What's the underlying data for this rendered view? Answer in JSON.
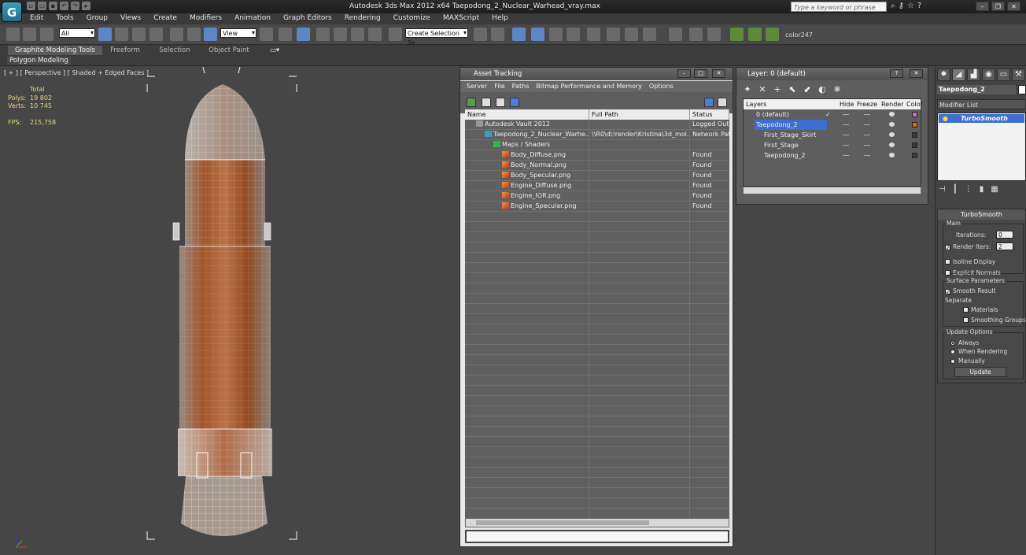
{
  "titlebar": {
    "title": "Autodesk 3ds Max  2012 x64      Taepodong_2_Nuclear_Warhead_vray.max",
    "search_placeholder": "Type a keyword or phrase",
    "logo": "G"
  },
  "menu": [
    "Edit",
    "Tools",
    "Group",
    "Views",
    "Create",
    "Modifiers",
    "Animation",
    "Graph Editors",
    "Rendering",
    "Customize",
    "MAXScript",
    "Help"
  ],
  "toolbar": {
    "filter_value": "All",
    "refcoord_value": "View",
    "selection_set_value": "Create Selection Se",
    "color_label": "color247"
  },
  "ribbon": {
    "tabs": [
      "Graphite Modeling Tools",
      "Freeform",
      "Selection",
      "Object Paint"
    ],
    "sub_label": "Polygon Modeling"
  },
  "viewport": {
    "label": "[ + ] [ Perspective ] [ Shaded + Edged Faces ]",
    "stats": {
      "total_label": "Total",
      "polys_label": "Polys:",
      "polys_value": "19 802",
      "verts_label": "Verts:",
      "verts_value": "10 745",
      "fps_label": "FPS:",
      "fps_value": "215,758"
    }
  },
  "asset_tracking": {
    "title": "Asset Tracking",
    "menu": [
      "Server",
      "File",
      "Paths",
      "Bitmap Performance and Memory",
      "Options"
    ],
    "columns": [
      "Name",
      "Full Path",
      "Status"
    ],
    "rows": [
      {
        "name": "Autodesk Vault 2012",
        "path": "",
        "status": "Logged Out",
        "indent": 0,
        "icon": "vault-icon"
      },
      {
        "name": "Taepodong_2_Nuclear_Warhe...",
        "path": "\\\\R0\\d\\!render\\Kristina\\3d_mol...",
        "status": "Network Pat",
        "indent": 1,
        "icon": "max-file-icon"
      },
      {
        "name": "Maps / Shaders",
        "path": "",
        "status": "",
        "indent": 2,
        "icon": "maps-icon"
      },
      {
        "name": "Body_Diffuse.png",
        "path": "",
        "status": "Found",
        "indent": 3,
        "icon": "image-file-icon"
      },
      {
        "name": "Body_Normal.png",
        "path": "",
        "status": "Found",
        "indent": 3,
        "icon": "image-file-icon"
      },
      {
        "name": "Body_Specular.png",
        "path": "",
        "status": "Found",
        "indent": 3,
        "icon": "image-file-icon"
      },
      {
        "name": "Engine_Diffuse.png",
        "path": "",
        "status": "Found",
        "indent": 3,
        "icon": "image-file-icon"
      },
      {
        "name": "Engine_IOR.png",
        "path": "",
        "status": "Found",
        "indent": 3,
        "icon": "image-file-icon"
      },
      {
        "name": "Engine_Specular.png",
        "path": "",
        "status": "Found",
        "indent": 3,
        "icon": "image-file-icon"
      }
    ]
  },
  "layer_manager": {
    "title": "Layer: 0 (default)",
    "columns": [
      "Layers",
      "Hide",
      "Freeze",
      "Render",
      "Color"
    ],
    "rows": [
      {
        "name": "0 (default)",
        "indent": 0,
        "color": "#c86ad6",
        "active": true,
        "selected": false
      },
      {
        "name": "Taepodong_2",
        "indent": 0,
        "color": "#e06418",
        "active": false,
        "selected": true
      },
      {
        "name": "First_Stage_Skirt",
        "indent": 1,
        "color": "#3a3a3a",
        "active": false,
        "selected": false
      },
      {
        "name": "First_Stage",
        "indent": 1,
        "color": "#3a3a3a",
        "active": false,
        "selected": false
      },
      {
        "name": "Taepodong_2",
        "indent": 1,
        "color": "#3a3a3a",
        "active": false,
        "selected": false
      }
    ]
  },
  "command_panel": {
    "object_name": "Taepodong_2",
    "modifier_list": "Modifier List",
    "modifier": "TurboSmooth",
    "rollout_title": "TurboSmooth",
    "main_label": "Main",
    "iterations_label": "Iterations:",
    "iterations_value": "0",
    "render_iters_label": "Render Iters:",
    "render_iters_value": "2",
    "isoline_label": "Isoline Display",
    "explicit_label": "Explicit Normals",
    "surface_label": "Surface Parameters",
    "smooth_label": "Smooth Result",
    "separate_label": "Separate",
    "materials_label": "Materials",
    "smoothing_label": "Smoothing Groups",
    "update_options_label": "Update Options",
    "always_label": "Always",
    "when_rendering_label": "When Rendering",
    "manually_label": "Manually",
    "update_button": "Update"
  },
  "colors": {
    "selection_blue": "#3d6ed2",
    "stats_yellow": "#e6d87a",
    "rust": "#a2552a"
  }
}
